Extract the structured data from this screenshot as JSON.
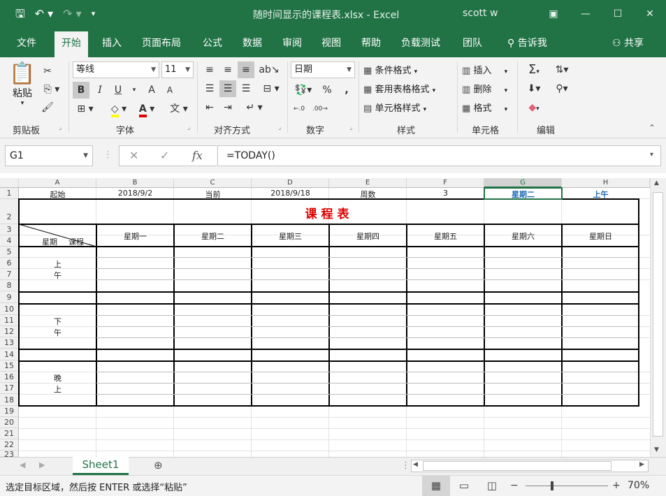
{
  "titlebar": {
    "title": "随时间显示的课程表.xlsx  -  Excel",
    "user": "scott w",
    "brand_color": "#217346"
  },
  "tabs": [
    "文件",
    "开始",
    "插入",
    "页面布局",
    "公式",
    "数据",
    "审阅",
    "视图",
    "帮助",
    "负载测试",
    "团队",
    "告诉我",
    "共享"
  ],
  "ribbon": {
    "clipboard": {
      "paste": "粘贴",
      "label": "剪贴板"
    },
    "font": {
      "name": "等线",
      "size": "11",
      "label": "字体",
      "bold": "B",
      "italic": "I",
      "underline": "U",
      "grow": "A",
      "shrink": "A",
      "fontcolor": "A",
      "wen": "文"
    },
    "alignment": {
      "label": "对齐方式"
    },
    "number": {
      "format": "日期",
      "label": "数字",
      "pct": "%",
      "comma": ","
    },
    "styles": {
      "cond": "条件格式",
      "table": "套用表格格式",
      "cell": "单元格样式",
      "label": "样式"
    },
    "cells": {
      "insert": "插入",
      "delete": "删除",
      "format": "格式",
      "label": "单元格"
    },
    "editing": {
      "label": "编辑"
    }
  },
  "formula": {
    "namebox": "G1",
    "value": "=TODAY()",
    "fx": "fx"
  },
  "columns": [
    "A",
    "B",
    "C",
    "D",
    "E",
    "F",
    "G",
    "H"
  ],
  "rows": [
    "1",
    "2",
    "3",
    "4",
    "5",
    "6",
    "7",
    "8",
    "9",
    "10",
    "11",
    "12",
    "13",
    "14",
    "15",
    "16",
    "17",
    "18",
    "19",
    "20",
    "21",
    "22",
    "23"
  ],
  "row1": {
    "a": "起始",
    "b": "2018/9/2",
    "c": "当前",
    "d": "2018/9/18",
    "e": "周数",
    "f": "3",
    "g": "星期二",
    "h": "上午",
    "highlight_color": "#1f6bb5"
  },
  "schedule": {
    "title": "课程表",
    "title_color": "#e00000",
    "corner_day": "星期",
    "corner_course": "课程",
    "days": [
      "星期一",
      "星期二",
      "星期三",
      "星期四",
      "星期五",
      "星期六",
      "星期日"
    ],
    "morning_1": "上",
    "morning_2": "午",
    "afternoon_1": "下",
    "afternoon_2": "午",
    "evening_1": "晚",
    "evening_2": "上"
  },
  "sheet": {
    "name": "Sheet1"
  },
  "status": {
    "message": "选定目标区域，然后按 ENTER 或选择“粘贴”",
    "zoom": "70%"
  }
}
